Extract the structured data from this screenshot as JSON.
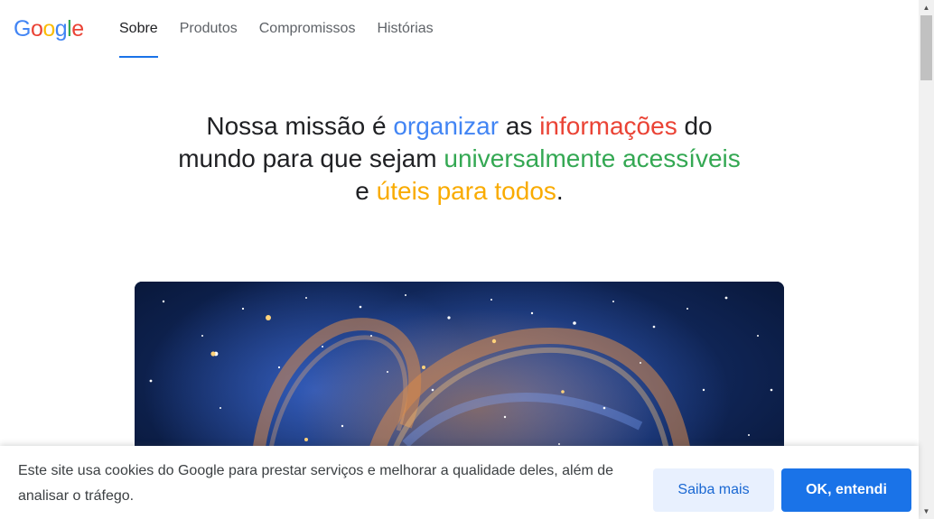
{
  "header": {
    "logo": {
      "letters": [
        "G",
        "o",
        "o",
        "g",
        "l",
        "e"
      ],
      "colors": [
        "#4285f4",
        "#ea4335",
        "#fbbc05",
        "#4285f4",
        "#34a853",
        "#ea4335"
      ]
    },
    "nav": [
      {
        "label": "Sobre",
        "active": true
      },
      {
        "label": "Produtos",
        "active": false
      },
      {
        "label": "Compromissos",
        "active": false
      },
      {
        "label": "Histórias",
        "active": false
      }
    ]
  },
  "mission": {
    "part1": "Nossa missão é ",
    "organizar": "organizar",
    "part2": " as ",
    "informacoes": "informações",
    "part3": " do mundo para que sejam ",
    "universalmente": "universalmente",
    "part4": " ",
    "acessiveis": "acessíveis",
    "part5": " e ",
    "uteis": "úteis para todos",
    "part6": "."
  },
  "hero": {
    "image_subject": "nebula-space-image"
  },
  "cookie": {
    "text": "Este site usa cookies do Google para prestar serviços e melhorar a qualidade deles, além de analisar o tráfego.",
    "learn_more": "Saiba mais",
    "ok": "OK, entendi"
  },
  "colors": {
    "accent": "#1a73e8",
    "blue": "#4285f4",
    "red": "#ea4335",
    "green": "#34a853",
    "yellow": "#f9ab00"
  }
}
